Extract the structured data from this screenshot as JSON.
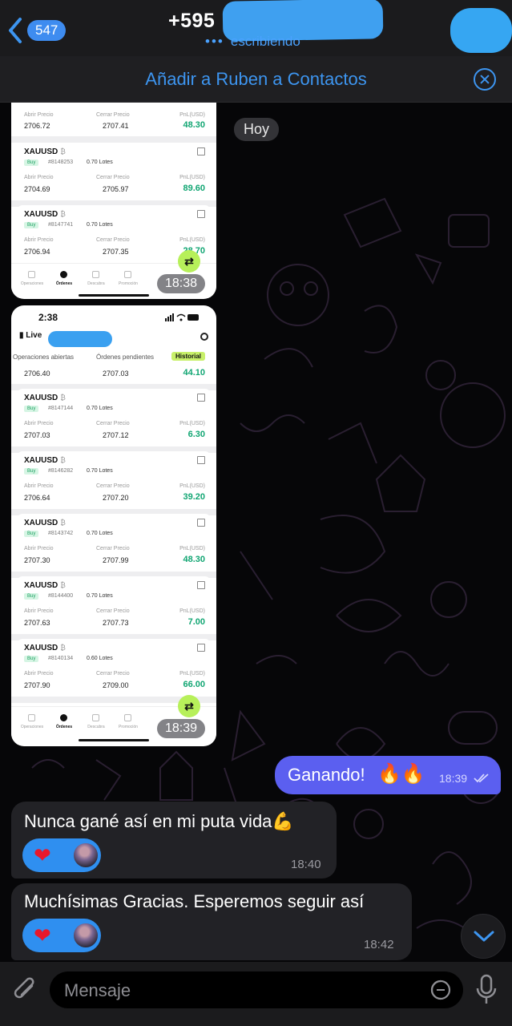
{
  "header": {
    "back_count": "547",
    "title": "+595",
    "status": "escribiendo",
    "status_dots": "•••"
  },
  "contact_bar": {
    "label": "Añadir a Ruben a Contactos"
  },
  "day_label": "Hoy",
  "screenshot1": {
    "trades": [
      {
        "symbol": "",
        "open_label": "Abrir Precio",
        "close_label": "Cerrar Precio",
        "pnl_label": "PnL(USD)",
        "open": "2706.72",
        "close": "2707.41",
        "pnl": "48.30",
        "side": "",
        "id": "",
        "lots": ""
      },
      {
        "symbol": "XAUUSD",
        "side": "Buy",
        "id": "#8148253",
        "lots": "0.70 Lotes",
        "open_label": "Abrir Precio",
        "close_label": "Cerrar Precio",
        "pnl_label": "PnL(USD)",
        "open": "2704.69",
        "close": "2705.97",
        "pnl": "89.60"
      },
      {
        "symbol": "XAUUSD",
        "side": "Buy",
        "id": "#8147741",
        "lots": "0.70 Lotes",
        "open_label": "Abrir Precio",
        "close_label": "Cerrar Precio",
        "pnl_label": "PnL(USD)",
        "open": "2706.94",
        "close": "2707.35",
        "pnl": "28.70"
      }
    ],
    "time": "18:38"
  },
  "screenshot2": {
    "status_time": "2:38",
    "live_label": "Live",
    "subtabs": [
      "Operaciones abiertas",
      "Órdenes pendientes",
      "Historial"
    ],
    "trades": [
      {
        "symbol": "",
        "open": "2706.40",
        "close": "2707.03",
        "pnl": "44.10",
        "side": "",
        "id": "",
        "lots": ""
      },
      {
        "symbol": "XAUUSD",
        "side": "Buy",
        "id": "#8147144",
        "lots": "0.70 Lotes",
        "open_label": "Abrir Precio",
        "close_label": "Cerrar Precio",
        "pnl_label": "PnL(USD)",
        "open": "2707.03",
        "close": "2707.12",
        "pnl": "6.30"
      },
      {
        "symbol": "XAUUSD",
        "side": "Buy",
        "id": "#8146282",
        "lots": "0.70 Lotes",
        "open_label": "Abrir Precio",
        "close_label": "Cerrar Precio",
        "pnl_label": "PnL(USD)",
        "open": "2706.64",
        "close": "2707.20",
        "pnl": "39.20"
      },
      {
        "symbol": "XAUUSD",
        "side": "Buy",
        "id": "#8143742",
        "lots": "0.70 Lotes",
        "open_label": "Abrir Precio",
        "close_label": "Cerrar Precio",
        "pnl_label": "PnL(USD)",
        "open": "2707.30",
        "close": "2707.99",
        "pnl": "48.30"
      },
      {
        "symbol": "XAUUSD",
        "side": "Buy",
        "id": "#8144400",
        "lots": "0.70 Lotes",
        "open_label": "Abrir Precio",
        "close_label": "Cerrar Precio",
        "pnl_label": "PnL(USD)",
        "open": "2707.63",
        "close": "2707.73",
        "pnl": "7.00"
      },
      {
        "symbol": "XAUUSD",
        "side": "Buy",
        "id": "#8140134",
        "lots": "0.60 Lotes",
        "open_label": "Abrir Precio",
        "close_label": "Cerrar Precio",
        "pnl_label": "PnL(USD)",
        "open": "2707.90",
        "close": "2709.00",
        "pnl": "66.00"
      }
    ],
    "time": "18:39"
  },
  "app_tabs": [
    "Operaciones",
    "Órdenes",
    "Descubra",
    "Promoción",
    "Perfil"
  ],
  "messages": {
    "out1": {
      "text": "Ganando!",
      "emoji": "🔥🔥",
      "time": "18:39"
    },
    "in1": {
      "text": "Nunca gané así en mi puta vida💪",
      "time": "18:40",
      "reaction": "❤"
    },
    "in2": {
      "text": "Muchísimas Gracias. Esperemos seguir así",
      "time": "18:42",
      "reaction": "❤"
    }
  },
  "input": {
    "placeholder": "Mensaje"
  },
  "colors": {
    "accent": "#3d95f0",
    "out_bubble": "#5b5ff0",
    "in_bubble": "#222226",
    "pnl_green": "#12a673",
    "historial_tab": "#c8f06a"
  }
}
